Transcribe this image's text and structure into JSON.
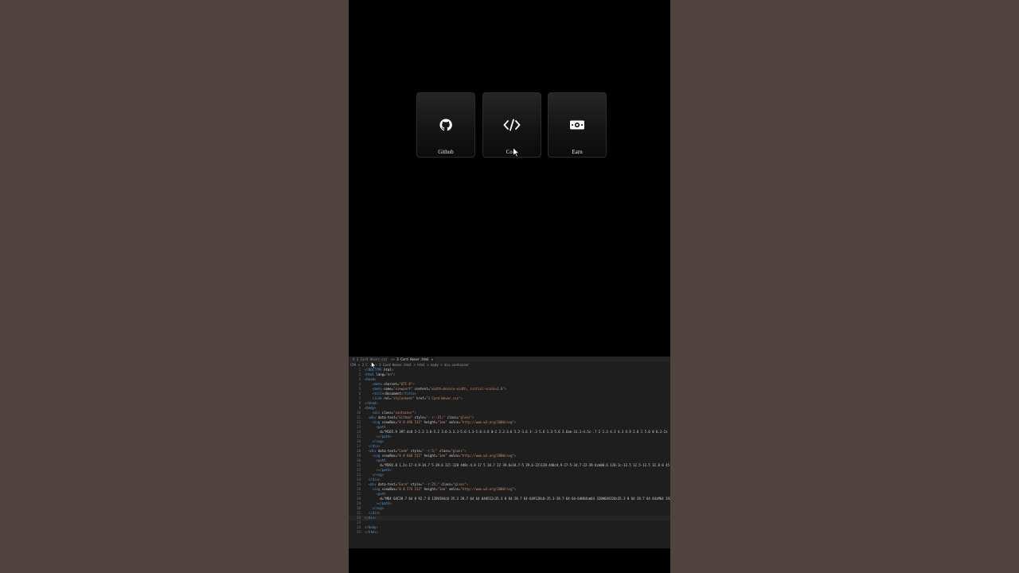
{
  "preview": {
    "cards": [
      {
        "label": "Github",
        "icon": "github-icon"
      },
      {
        "label": "Code",
        "icon": "code-icon"
      },
      {
        "label": "Earn",
        "icon": "money-bill-icon"
      }
    ]
  },
  "editor": {
    "tabs": [
      {
        "label": "3 Card Hover.css"
      },
      {
        "label": "3 Card Hover.html"
      }
    ],
    "breadcrumb": "CPA > 3 C... > 3 Card Hover.html > html > body > div.container",
    "lines": [
      {
        "n": "1",
        "text": "<!DOCTYPE html>"
      },
      {
        "n": "2",
        "text": "<html lang=\"en\">"
      },
      {
        "n": "3",
        "text": "<head>"
      },
      {
        "n": "4",
        "text": "    <meta charset=\"UTF-8\">"
      },
      {
        "n": "5",
        "text": "    <meta name=\"viewport\" content=\"width=device-width, initial-scale=1.0\">"
      },
      {
        "n": "6",
        "text": "    <title>Document</title>"
      },
      {
        "n": "7",
        "text": "    <link rel=\"stylesheet\" href=\"3 Card Hover.css\">"
      },
      {
        "n": "8",
        "text": "</head>"
      },
      {
        "n": "9",
        "text": "<body>"
      },
      {
        "n": "10",
        "text": "    <div class=\"container\">"
      },
      {
        "n": "11",
        "text": "  <div data-text=\"Github\" style=\"--r:-15;\" class=\"glass\">"
      },
      {
        "n": "12",
        "text": "    <svg viewBox=\"0 0 496 512\" height=\"1em\" xmlns=\"http://www.w3.org/2000/svg\">"
      },
      {
        "n": "13",
        "text": "      <path"
      },
      {
        "n": "14",
        "text": "        d=\"M165.9 397.4c0 2-2.3 3.6-5.2 3.6-3.3.3-5.6-1.3-5.6-3.6 0-2 2.3-3.6 5.2-3.6 3-.3 5.6 1.3 5.6 3.6zm-31.1-4.5c-.7 2 1.3 4.3 4.3 4.9 2.6 1 5.6 0 6.2-2z"
      },
      {
        "n": "15",
        "text": "      ></path>"
      },
      {
        "n": "16",
        "text": "    </svg>"
      },
      {
        "n": "17",
        "text": "  </div>"
      },
      {
        "n": "18",
        "text": "  <div data-text=\"Code\" style=\"--r:5;\" class=\"glass\">"
      },
      {
        "n": "19",
        "text": "    <svg viewBox=\"0 0 640 512\" height=\"1em\" xmlns=\"http://www.w3.org/2000/svg\">"
      },
      {
        "n": "20",
        "text": "      <path"
      },
      {
        "n": "21",
        "text": "        d=\"M392.8 1.2c-17-4.9-34.7 5-39.6 22l-128 448c-4.9 17 5 34.7 22 39.6s34.7-5 39.6-22l128-448c4.9-17-5-34.7-22-39.6zm80.6 120.1c-12.5 12.5-12.5 32.8 0 45.3"
      },
      {
        "n": "22",
        "text": "      ></path>"
      },
      {
        "n": "23",
        "text": "    </svg>"
      },
      {
        "n": "24",
        "text": "  </div>"
      },
      {
        "n": "25",
        "text": "  <div data-text=\"Earn\" style=\"--r:25;\" class=\"glass\">"
      },
      {
        "n": "26",
        "text": "    <svg viewBox=\"0 0 576 512\" height=\"1em\" xmlns=\"http://www.w3.org/2000/svg\">"
      },
      {
        "n": "27",
        "text": "      <path"
      },
      {
        "n": "28",
        "text": "        d=\"M64 64C28.7 64 0 92.7 0 128V384c0 35.3 28.7 64 64 64H512c35.3 0 64-28.7 64-64V128c0-35.3-28.7-64-64-64H64zm64 320H64V320c35.3 0 64 28.7 64 64zM64 192V128"
      },
      {
        "n": "29",
        "text": "      ></path>"
      },
      {
        "n": "30",
        "text": "    </svg>"
      },
      {
        "n": "31",
        "text": "  </div>"
      },
      {
        "n": "32",
        "text": "</div>"
      },
      {
        "n": "33",
        "text": ""
      },
      {
        "n": "34",
        "text": "</body>"
      },
      {
        "n": "35",
        "text": "</html>"
      }
    ]
  }
}
